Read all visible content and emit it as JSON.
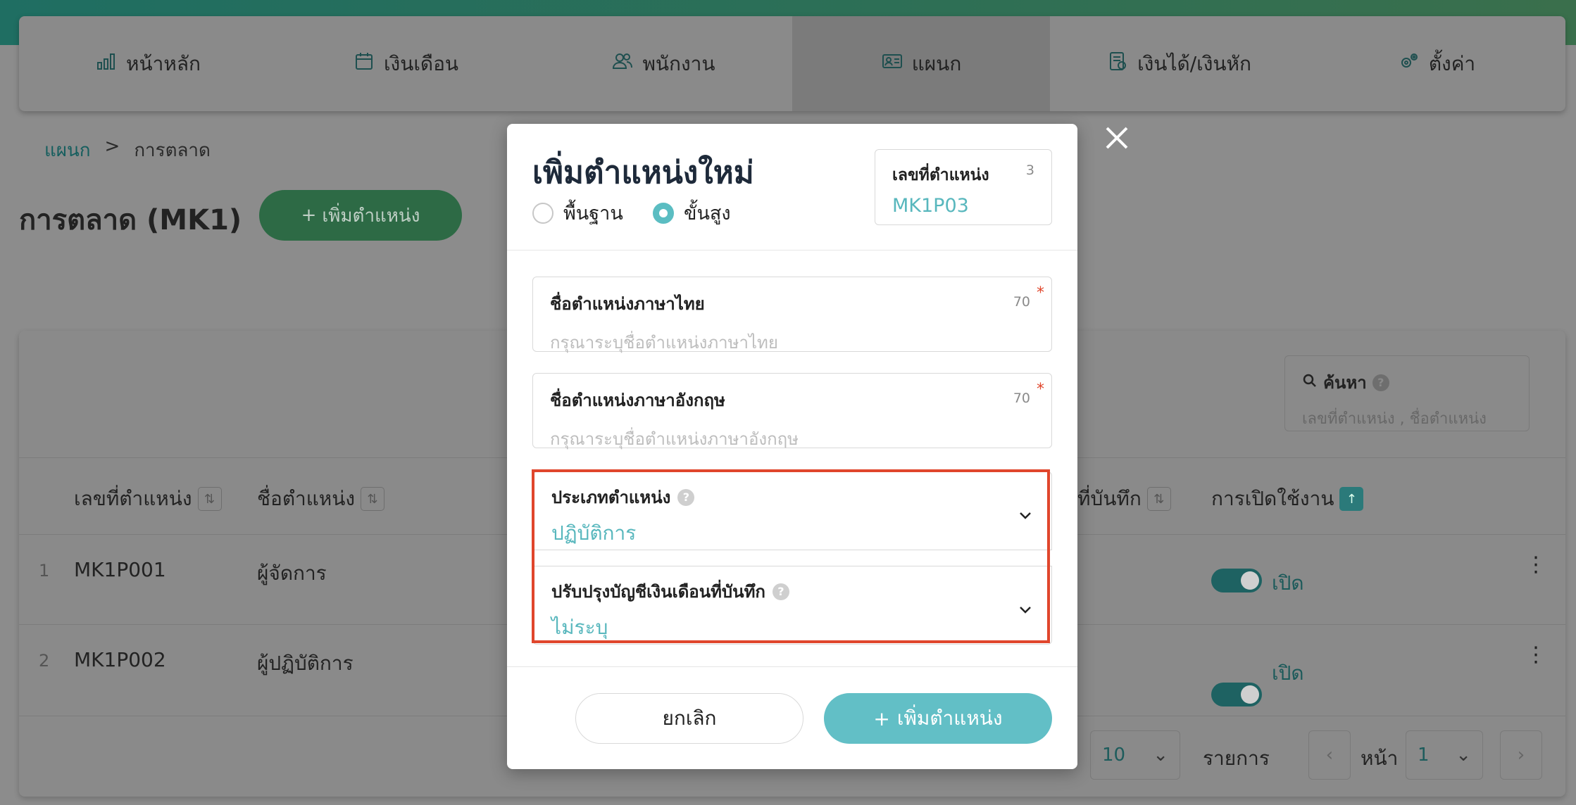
{
  "nav": {
    "items": [
      {
        "label": "หน้าหลัก",
        "icon": "bar-chart-icon"
      },
      {
        "label": "เงินเดือน",
        "icon": "calendar-icon"
      },
      {
        "label": "พนักงาน",
        "icon": "users-icon"
      },
      {
        "label": "แผนก",
        "icon": "id-card-icon"
      },
      {
        "label": "เงินได้/เงินหัก",
        "icon": "money-doc-icon"
      },
      {
        "label": "ตั้งค่า",
        "icon": "gears-icon"
      }
    ],
    "active_index": 3
  },
  "breadcrumb": {
    "root": "แผนก",
    "separator": ">",
    "current": "การตลาด"
  },
  "page": {
    "title": "การตลาด (MK1)",
    "add_button": "เพิ่มตำแหน่ง",
    "search_label": "ค้นหา",
    "search_placeholder": "เลขที่ตำแหน่ง , ชื่อตำแหน่ง"
  },
  "table": {
    "headers": {
      "code": "เลขที่ตำแหน่ง",
      "name": "ชื่อตำแหน่ง",
      "saved": "ที่บันทึก",
      "enabled": "การเปิดใช้งาน"
    },
    "rows": [
      {
        "num": "1",
        "code": "MK1P001",
        "name": "ผู้จัดการ",
        "status": "เปิด"
      },
      {
        "num": "2",
        "code": "MK1P002",
        "name": "ผู้ปฏิบัติการ",
        "status": "เปิด"
      }
    ]
  },
  "pagination": {
    "page_size": "10",
    "items_label": "รายการ",
    "page_label": "หน้า",
    "page": "1"
  },
  "modal": {
    "title": "เพิ่มตำแหน่งใหม่",
    "mode_basic": "พื้นฐาน",
    "mode_advanced": "ขั้นสูง",
    "selected_mode": "advanced",
    "code_label": "เลขที่ตำแหน่ง",
    "code_count": "3",
    "code_value": "MK1P03",
    "thai_name_label": "ชื่อตำแหน่งภาษาไทย",
    "thai_name_count": "70",
    "thai_name_placeholder": "กรุณาระบุชื่อตำแหน่งภาษาไทย",
    "en_name_label": "ชื่อตำแหน่งภาษาอังกฤษ",
    "en_name_count": "70",
    "en_name_placeholder": "กรุณาระบุชื่อตำแหน่งภาษาอังกฤษ",
    "required_mark": "*",
    "position_type_label": "ประเภทตำแหน่ง",
    "position_type_value": "ปฏิบัติการ",
    "payroll_label": "ปรับปรุงบัญชีเงินเดือนที่บันทึก",
    "payroll_value": "ไม่ระบุ",
    "cancel": "ยกเลิก",
    "submit": "เพิ่มตำแหน่ง"
  },
  "colors": {
    "accent": "#62bfc6",
    "highlight": "#e0462c",
    "brand_green": "#2d6a45"
  }
}
